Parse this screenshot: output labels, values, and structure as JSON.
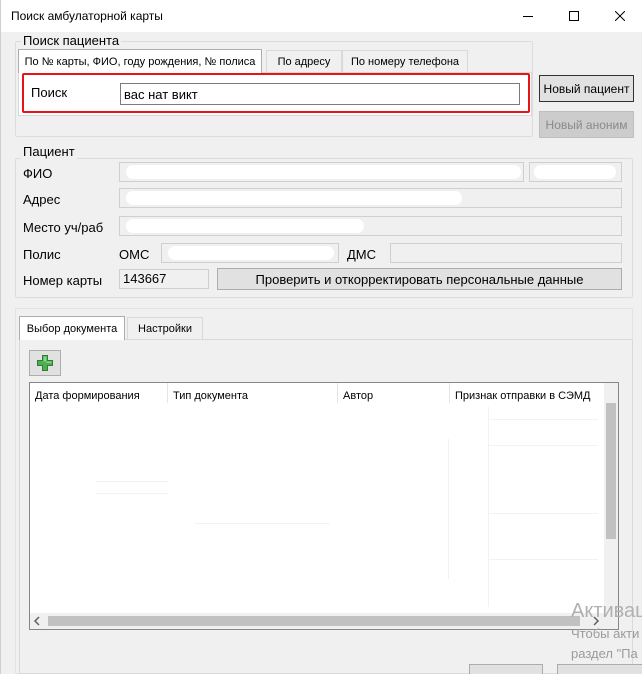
{
  "window": {
    "title": "Поиск амбулаторной карты"
  },
  "patient_search": {
    "legend": "Поиск пациента",
    "tabs": [
      {
        "label": "По № карты, ФИО, году рождения, № полиса",
        "active": true
      },
      {
        "label": "По адресу",
        "active": false
      },
      {
        "label": "По номеру телефона",
        "active": false
      }
    ],
    "search_label": "Поиск",
    "search_value": "вас нат викт"
  },
  "actions": {
    "new_patient": "Новый пациент",
    "new_anonymous": "Новый аноним"
  },
  "patient": {
    "legend": "Пациент",
    "fio_label": "ФИО",
    "address_label": "Адрес",
    "workplace_label": "Место уч/раб",
    "policy_label": "Полис",
    "oms_label": "ОМС",
    "dms_label": "ДМС",
    "card_label": "Номер карты",
    "card_number": "143667",
    "verify_button": "Проверить и откорректировать персональные данные"
  },
  "documents": {
    "tabs": [
      {
        "label": "Выбор документа",
        "active": true
      },
      {
        "label": "Настройки",
        "active": false
      }
    ],
    "add_icon": "plus-icon",
    "columns": [
      "Дата формирования",
      "Тип документа",
      "Автор",
      "Признак отправки в СЭМД"
    ]
  },
  "watermark": {
    "title": "Активац",
    "line1": "Чтобы акти",
    "line2": "раздел \"Па"
  }
}
